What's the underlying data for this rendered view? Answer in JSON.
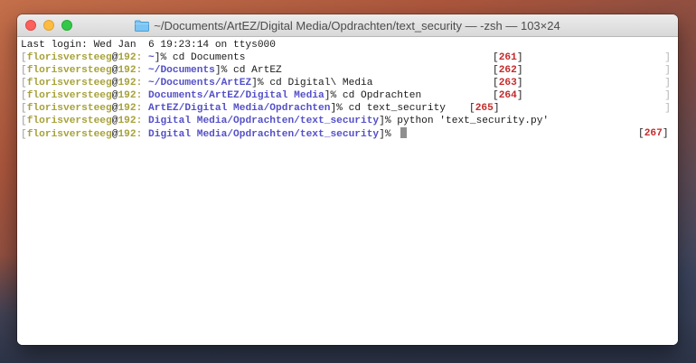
{
  "window": {
    "title": "~/Documents/ArtEZ/Digital Media/Opdrachten/text_security — -zsh — 103×24"
  },
  "terminal": {
    "login": "Last login: Wed Jan  6 19:23:14 on ttys000",
    "lines": [
      {
        "user": "florisversteeg",
        "host": "192",
        "path": "~",
        "sep": "]%",
        "cmd": " cd Documents",
        "hist": "261"
      },
      {
        "user": "florisversteeg",
        "host": "192",
        "path": "~/Documents",
        "sep": "]%",
        "cmd": " cd ArtEZ",
        "hist": "262"
      },
      {
        "user": "florisversteeg",
        "host": "192",
        "path": "~/Documents/ArtEZ",
        "sep": "]%",
        "cmd": " cd Digital\\ Media",
        "hist": "263"
      },
      {
        "user": "florisversteeg",
        "host": "192",
        "path": "Documents/ArtEZ/Digital Media",
        "sep": "]%",
        "cmd": " cd Opdrachten",
        "hist": "264"
      },
      {
        "user": "florisversteeg",
        "host": "192",
        "path": "ArtEZ/Digital Media/Opdrachten",
        "sep": "]%",
        "cmd": " cd text_security",
        "hist": "265"
      },
      {
        "user": "florisversteeg",
        "host": "192",
        "path": "Digital Media/Opdrachten/text_security",
        "sep": "]%",
        "cmd": " python 'text_security.py'",
        "hist": ""
      },
      {
        "user": "florisversteeg",
        "host": "192",
        "path": "Digital Media/Opdrachten/text_security",
        "sep": "]%",
        "cmd": " ",
        "hist": "267"
      }
    ]
  },
  "colors": {
    "user": "#a7a23a",
    "path": "#5450c8",
    "history": "#c42b2b"
  }
}
